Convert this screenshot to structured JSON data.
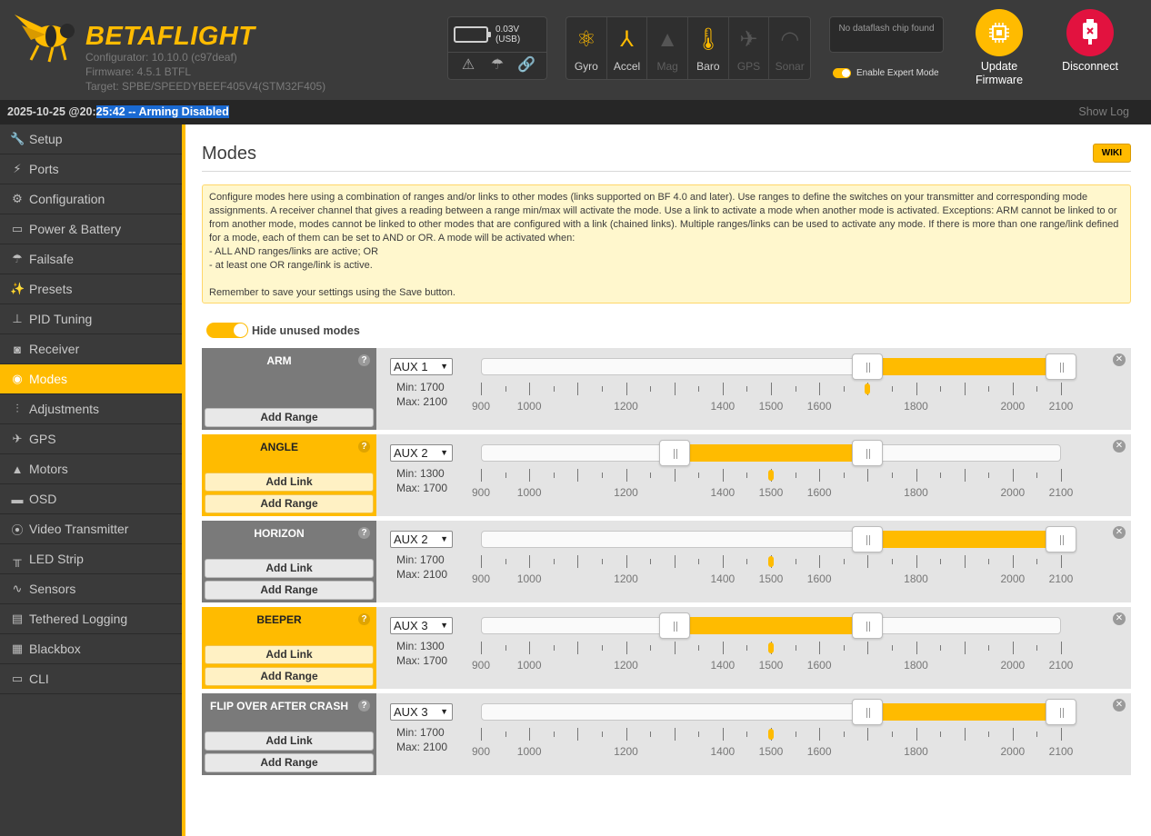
{
  "header": {
    "logo_text": "BETAFLIGHT",
    "configurator": "Configurator: 10.10.0 (c97deaf)",
    "firmware": "Firmware: 4.5.1 BTFL",
    "target": "Target: SPBE/SPEEDYBEEF405V4(STM32F405)",
    "battery_voltage": "0.03V (USB)",
    "sensors": [
      {
        "label": "Gyro",
        "icon": "gyro-icon",
        "active": true
      },
      {
        "label": "Accel",
        "icon": "accel-icon",
        "active": true
      },
      {
        "label": "Mag",
        "icon": "mag-icon",
        "active": false
      },
      {
        "label": "Baro",
        "icon": "baro-icon",
        "active": true
      },
      {
        "label": "GPS",
        "icon": "gps-icon",
        "active": false
      },
      {
        "label": "Sonar",
        "icon": "sonar-icon",
        "active": false
      }
    ],
    "dataflash": "No dataflash chip found",
    "expert_mode_label": "Enable Expert Mode",
    "update_firmware_label": "Update Firmware",
    "disconnect_label": "Disconnect"
  },
  "statusbar": {
    "timestamp_prefix": "2025-10-25 @20:",
    "selected_text": "25:42 -- Arming Disabled",
    "show_log": "Show Log"
  },
  "sidebar": {
    "items": [
      {
        "label": "Setup",
        "icon": "wrench-icon"
      },
      {
        "label": "Ports",
        "icon": "plug-icon"
      },
      {
        "label": "Configuration",
        "icon": "gear-icon"
      },
      {
        "label": "Power & Battery",
        "icon": "battery-icon"
      },
      {
        "label": "Failsafe",
        "icon": "parachute-icon"
      },
      {
        "label": "Presets",
        "icon": "wand-icon"
      },
      {
        "label": "PID Tuning",
        "icon": "sitemap-icon"
      },
      {
        "label": "Receiver",
        "icon": "gamepad-icon"
      },
      {
        "label": "Modes",
        "icon": "toggle-icon"
      },
      {
        "label": "Adjustments",
        "icon": "sliders-icon"
      },
      {
        "label": "GPS",
        "icon": "satellite-icon"
      },
      {
        "label": "Motors",
        "icon": "motor-icon"
      },
      {
        "label": "OSD",
        "icon": "osd-icon"
      },
      {
        "label": "Video Transmitter",
        "icon": "antenna-icon"
      },
      {
        "label": "LED Strip",
        "icon": "led-icon"
      },
      {
        "label": "Sensors",
        "icon": "pulse-icon"
      },
      {
        "label": "Tethered Logging",
        "icon": "logging-icon"
      },
      {
        "label": "Blackbox",
        "icon": "blackbox-icon"
      },
      {
        "label": "CLI",
        "icon": "terminal-icon"
      }
    ],
    "active": "Modes"
  },
  "page": {
    "title": "Modes",
    "wiki": "WIKI",
    "note_lines": [
      "Configure modes here using a combination of ranges and/or links to other modes (links supported on BF 4.0 and later). Use ranges to define the switches on your transmitter and corresponding mode assignments. A receiver channel that gives a reading between a range min/max will activate the mode. Use a link to activate a mode when another mode is activated. Exceptions: ARM cannot be linked to or from another mode, modes cannot be linked to other modes that are configured with a link (chained links). Multiple ranges/links can be used to activate any mode. If there is more than one range/link defined for a mode, each of them can be set to AND or OR. A mode will be activated when:",
      "- ALL AND ranges/links are active; OR",
      "- at least one OR range/link is active.",
      "",
      "Remember to save your settings using the Save button."
    ],
    "hide_unused": "Hide unused modes",
    "add_link": "Add Link",
    "add_range": "Add Range",
    "tick_labels": [
      "900",
      "1000",
      "1200",
      "1400",
      "1500",
      "1600",
      "1800",
      "2000",
      "2100"
    ],
    "modes": [
      {
        "name": "ARM",
        "active": false,
        "has_link": false,
        "channel": "AUX 1",
        "min_label": "Min: 1700",
        "max_label": "Max: 2100",
        "min": 1700,
        "max": 2100,
        "current": 1700
      },
      {
        "name": "ANGLE",
        "active": true,
        "has_link": true,
        "channel": "AUX 2",
        "min_label": "Min: 1300",
        "max_label": "Max: 1700",
        "min": 1300,
        "max": 1700,
        "current": 1500
      },
      {
        "name": "HORIZON",
        "active": false,
        "has_link": true,
        "channel": "AUX 2",
        "min_label": "Min: 1700",
        "max_label": "Max: 2100",
        "min": 1700,
        "max": 2100,
        "current": 1500
      },
      {
        "name": "BEEPER",
        "active": true,
        "has_link": true,
        "channel": "AUX 3",
        "min_label": "Min: 1300",
        "max_label": "Max: 1700",
        "min": 1300,
        "max": 1700,
        "current": 1500
      },
      {
        "name": "FLIP OVER AFTER CRASH",
        "active": false,
        "has_link": true,
        "channel": "AUX 3",
        "min_label": "Min: 1700",
        "max_label": "Max: 2100",
        "min": 1700,
        "max": 2100,
        "current": 1500
      }
    ]
  },
  "colors": {
    "accent": "#ffbb00",
    "header": "#3b3b3b",
    "sidebar": "#3a3a3a",
    "disconnect": "#e2123f",
    "selection": "#1a6ad2"
  }
}
